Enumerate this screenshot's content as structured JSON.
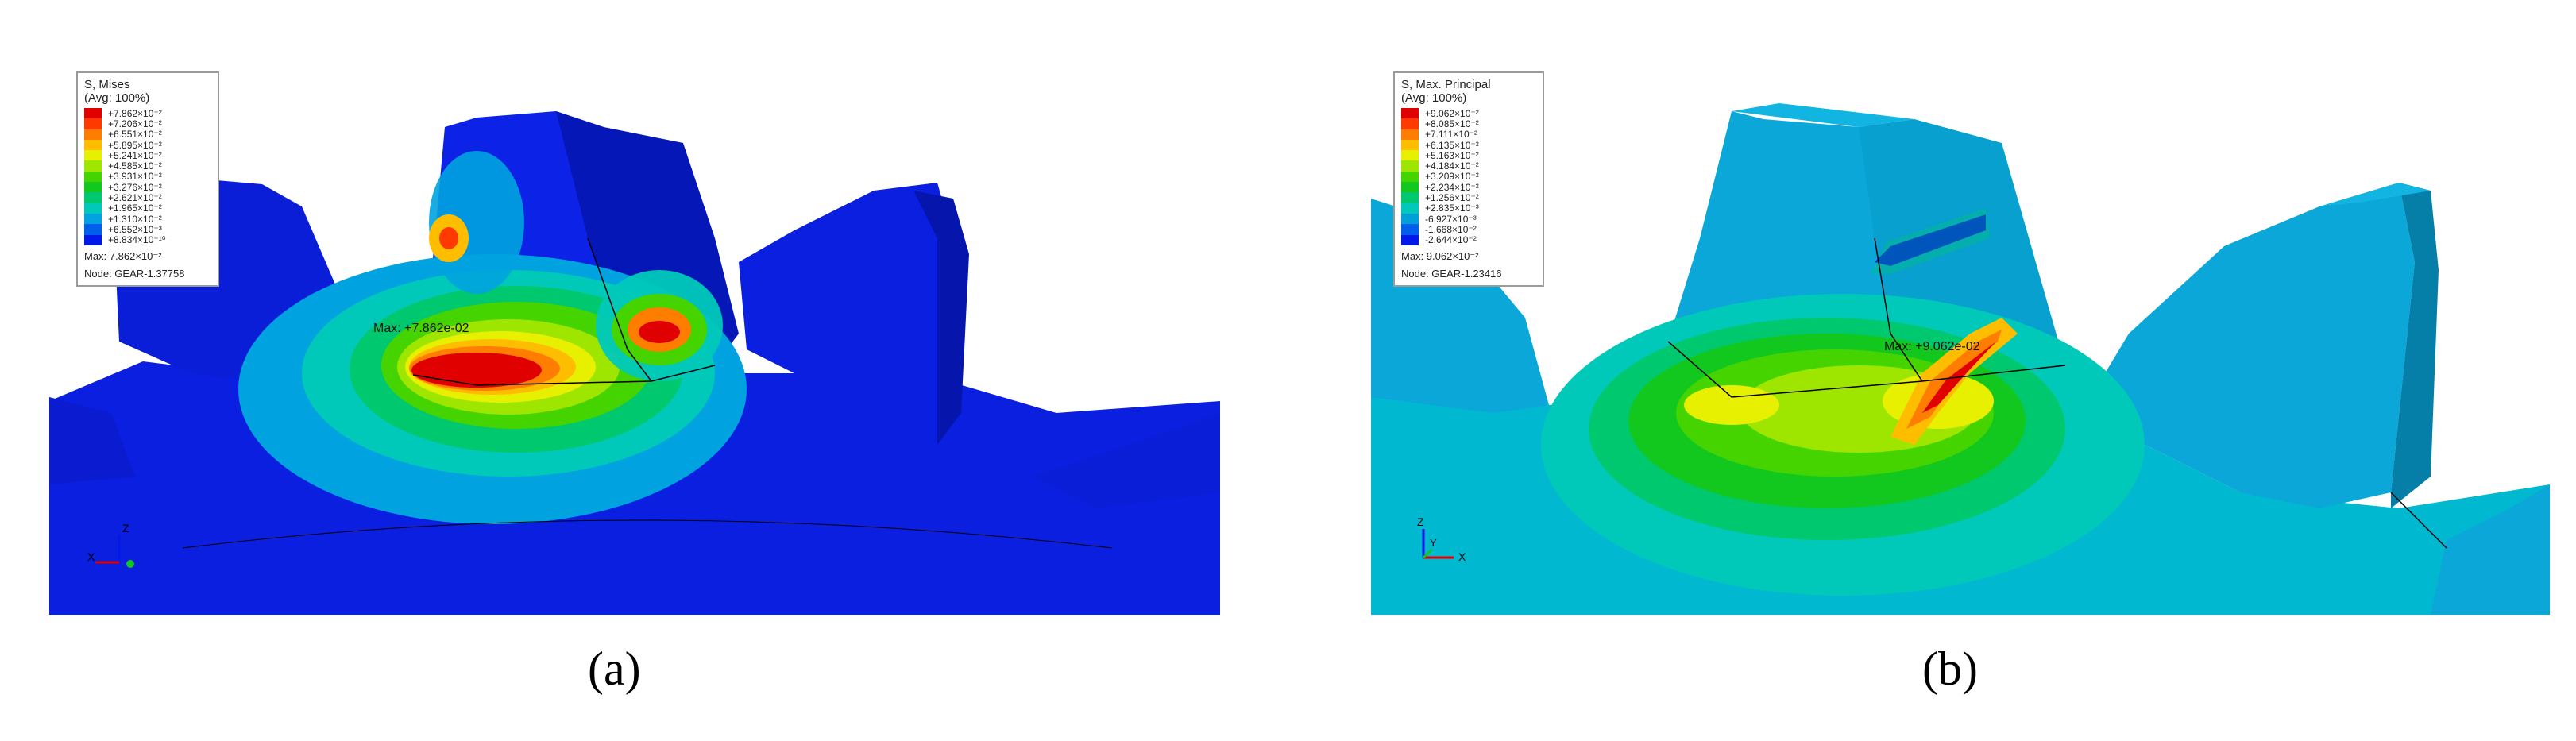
{
  "panel_a": {
    "caption": "(a)",
    "legend": {
      "title": "S, Mises",
      "subtitle": "(Avg: 100%)",
      "entries": [
        "+7.862×10⁻²",
        "+7.206×10⁻²",
        "+6.551×10⁻²",
        "+5.895×10⁻²",
        "+5.241×10⁻²",
        "+4.585×10⁻²",
        "+3.931×10⁻²",
        "+3.276×10⁻²",
        "+2.621×10⁻²",
        "+1.965×10⁻²",
        "+1.310×10⁻²",
        "+6.552×10⁻³",
        "+8.834×10⁻¹⁰"
      ],
      "colors": [
        "#e00000",
        "#ff3a00",
        "#ff7d00",
        "#ffbd00",
        "#e7f000",
        "#9ee600",
        "#46d400",
        "#12c81e",
        "#00c86e",
        "#00c9b9",
        "#00a3df",
        "#005fea",
        "#0018e8"
      ],
      "max_text": "Max: 7.862×10⁻²",
      "node_text": "Node: GEAR-1.37758"
    },
    "max_label": "Max: +7.862e-02",
    "triad": [
      "Z",
      "X"
    ]
  },
  "panel_b": {
    "caption": "(b)",
    "legend": {
      "title": "S, Max. Principal",
      "subtitle": "(Avg: 100%)",
      "entries": [
        "+9.062×10⁻²",
        "+8.085×10⁻²",
        "+7.111×10⁻²",
        "+6.135×10⁻²",
        "+5.163×10⁻²",
        "+4.184×10⁻²",
        "+3.209×10⁻²",
        "+2.234×10⁻²",
        "+1.256×10⁻²",
        "+2.835×10⁻³",
        "-6.927×10⁻³",
        "-1.668×10⁻²",
        "-2.644×10⁻²"
      ],
      "colors": [
        "#e00000",
        "#ff3a00",
        "#ff7d00",
        "#ffbd00",
        "#e7f000",
        "#9ee600",
        "#46d400",
        "#12c81e",
        "#00c86e",
        "#00c9b9",
        "#009fd8",
        "#005fea",
        "#0018e8"
      ],
      "max_text": "Max: 9.062×10⁻²",
      "node_text": "Node: GEAR-1.23416"
    },
    "max_label": "Max: +9.062e-02",
    "triad": [
      "Z",
      "Y",
      "X"
    ]
  }
}
